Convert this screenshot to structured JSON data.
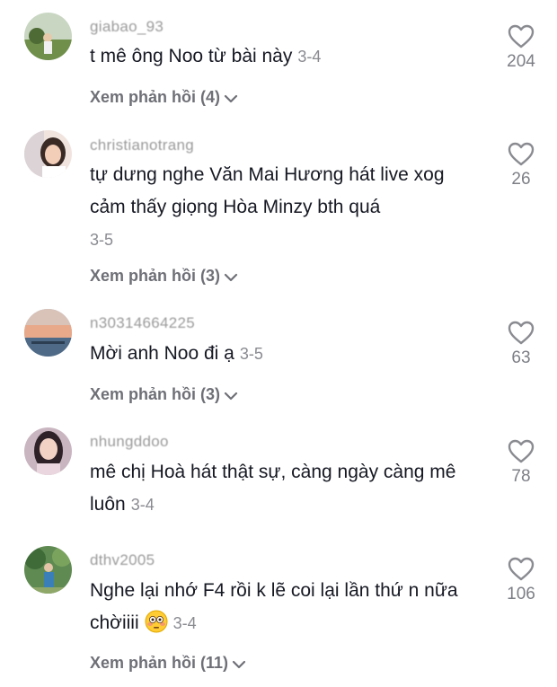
{
  "reply_prefix": "Xem phản hồi",
  "comments": [
    {
      "username": "giabao_93",
      "text": "t mê ông Noo từ bài này",
      "date": "3-4",
      "likes": "204",
      "replies": "Xem phản hồi (4)"
    },
    {
      "username": "christianotrang",
      "text": "tự dưng nghe Văn Mai Hương hát live xog cảm thấy giọng Hòa Minzy bth quá",
      "date": "3-5",
      "likes": "26",
      "replies": "Xem phản hồi (3)"
    },
    {
      "username": "n30314664225",
      "text": "Mời anh Noo đi ạ",
      "date": "3-5",
      "likes": "63",
      "replies": "Xem phản hồi (3)"
    },
    {
      "username": "nhungddoo",
      "text": "mê chị Hoà hát thật sự, càng ngày càng mê luôn",
      "date": "3-4",
      "likes": "78",
      "replies": ""
    },
    {
      "username": "dthv2005",
      "text": "Nghe lại nhớ F4 rồi k lẽ coi lại lần thứ n nữa chờiiii",
      "date": "3-4",
      "likes": "106",
      "replies": "Xem phản hồi (11)",
      "emoji": "flushed-face"
    }
  ]
}
